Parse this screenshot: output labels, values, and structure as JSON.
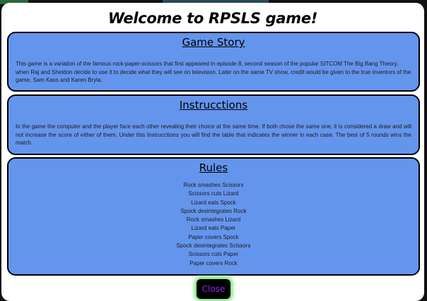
{
  "modal": {
    "title": "Welcome to RPSLS game!",
    "close_label": "Close"
  },
  "story": {
    "heading": "Game Story",
    "text": "This game is a variation of the famous rock-paper-scissors that first appeared in episode 8, second season of the popular SITCOM The Big Bang Theory, when Raj and Sheldon decide to use it to decide what they will see on television. Later on the same TV show, credit would be given to the true inventors of the game, Sam Kass and Karen Bryla."
  },
  "instructions": {
    "heading": "Instrucctions",
    "text": "In the game the computer and the player face each other revealing their choice at the same time. If both chose the same one, it is considered a draw and will not increase the score of either of them. Under this Instrucctions you will find the table that indicates the winner in each case. The best of 5 rounds wins the match."
  },
  "rules": {
    "heading": "Rules",
    "items": [
      "Rock smashes Scissors",
      "Scissors cuts Lizard",
      "Lizard eats Spock",
      "Spock desintegrates Rock",
      "Rock smashes Lizard",
      "Lizard eats Paper",
      "Paper covers Spock",
      "Spock desintegrates Scissors",
      "Scissors cuts Paper",
      "Paper covers Rock"
    ]
  },
  "colors": {
    "section_bg": "#6495ed",
    "close_text": "#8a2be2",
    "close_glow": "#6ee06e"
  }
}
